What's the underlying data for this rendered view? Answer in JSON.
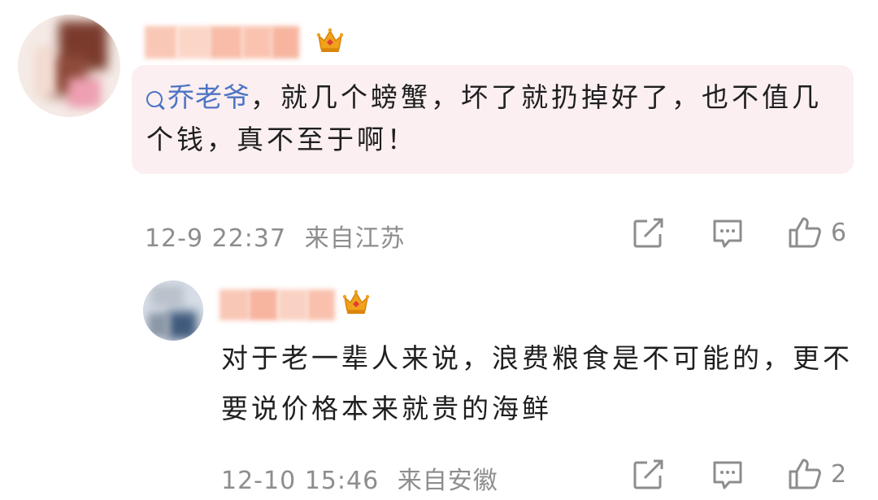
{
  "comment": {
    "username": "",
    "mention_tag": "乔老爷",
    "text": "，就几个螃蟹，坏了就扔掉好了，也不值几个钱，真不至于啊！",
    "time": "12-9 22:37",
    "location": "来自江苏",
    "like_count": "6"
  },
  "reply": {
    "username": "",
    "text": "对于老一辈人来说，浪费粮食是不可能的，更不要说价格本来就贵的海鲜",
    "time": "12-10 15:46",
    "location": "来自安徽",
    "like_count": "2"
  },
  "icons": {
    "crown": "vip-crown-icon",
    "search": "search-icon",
    "repost": "repost-icon",
    "comment": "comment-icon",
    "like": "like-icon"
  },
  "colors": {
    "bubble_background": "#fbeff1",
    "mention_blue": "#4e74c4",
    "meta_gray": "#8d8d8d",
    "crown_gold": "#f0a21a",
    "crown_red": "#e23b3b"
  }
}
